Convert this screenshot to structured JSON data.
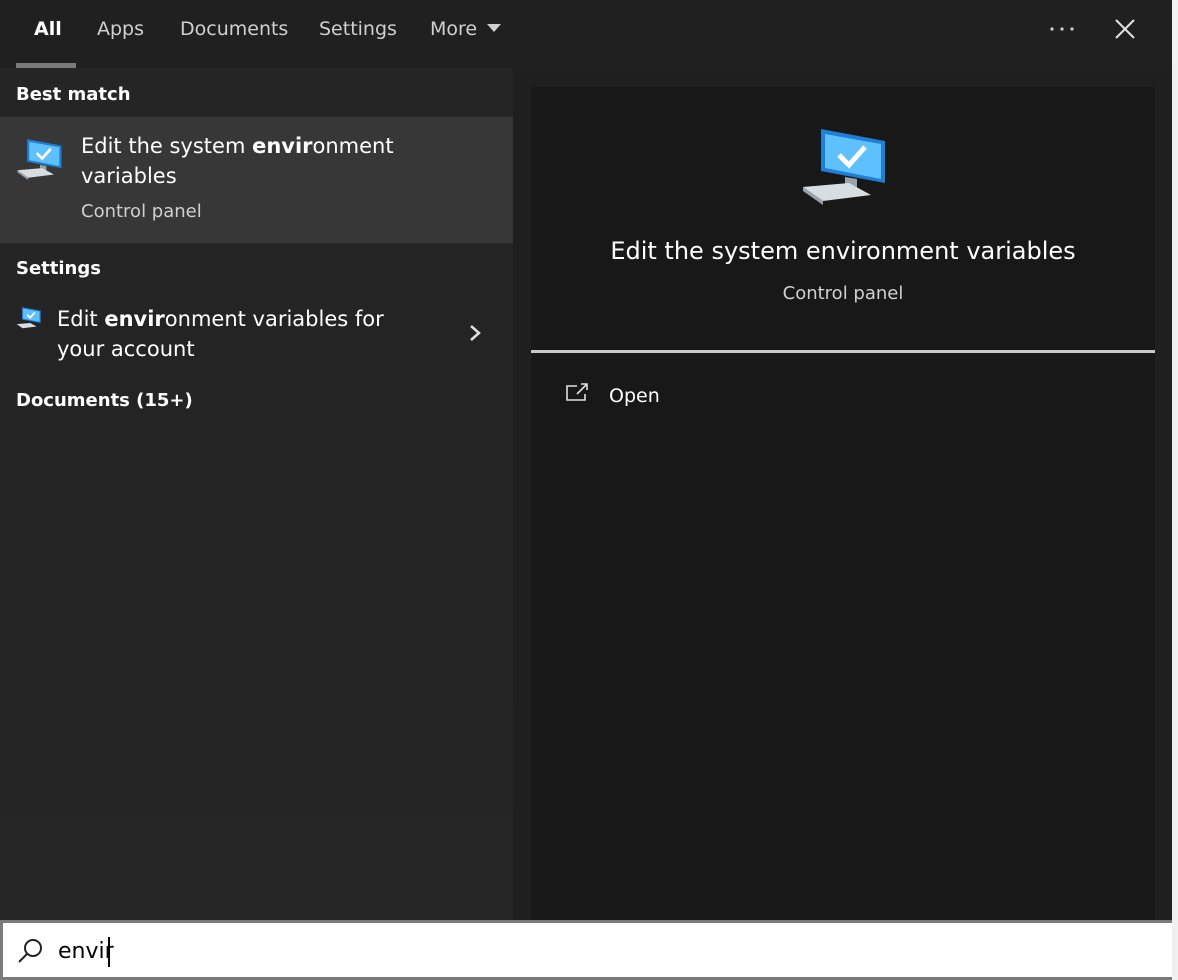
{
  "tabs": [
    {
      "label": "All",
      "active": true
    },
    {
      "label": "Apps"
    },
    {
      "label": "Documents"
    },
    {
      "label": "Settings"
    },
    {
      "label": "More"
    }
  ],
  "toolbar": {
    "more_options_icon": "ellipsis-icon",
    "close_icon": "close-icon"
  },
  "best_match": {
    "header": "Best match",
    "title_parts": [
      "Edit the system ",
      "envir",
      "onment variables"
    ],
    "subtitle": "Control panel",
    "icon": "computer-monitor-icon"
  },
  "settings": {
    "header": "Settings",
    "title_parts": [
      "Edit ",
      "envir",
      "onment variables for your account"
    ],
    "icon": "computer-monitor-icon"
  },
  "documents": {
    "header": "Documents (15+)"
  },
  "preview": {
    "title": "Edit the system environment variables",
    "subtitle": "Control panel",
    "icon": "computer-monitor-icon",
    "actions": [
      {
        "label": "Open",
        "icon": "open-external-icon"
      }
    ]
  },
  "search": {
    "value": "envir",
    "icon": "search-icon"
  },
  "colors": {
    "accent": "#3a9ee8",
    "selection": "#373737",
    "background": "#202020"
  }
}
